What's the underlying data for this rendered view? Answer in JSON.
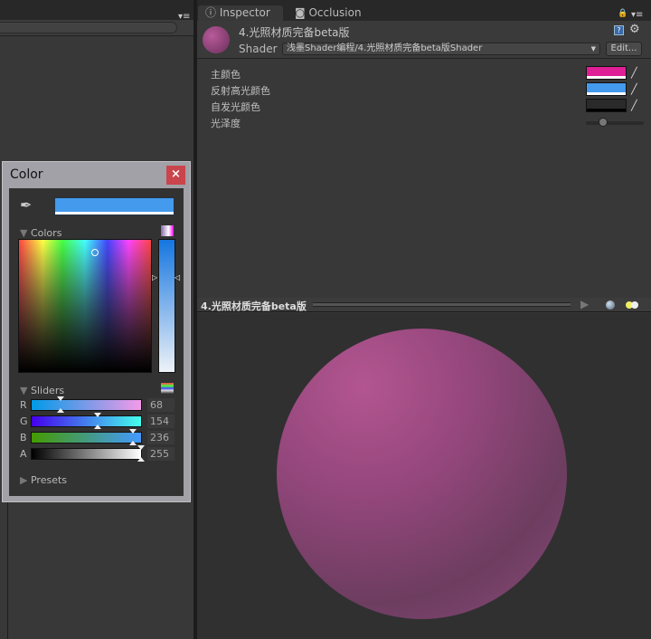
{
  "tabs": [
    {
      "label": "Inspector",
      "icon": "info-icon",
      "active": true
    },
    {
      "label": "Occlusion",
      "icon": "occlusion-icon",
      "active": false
    }
  ],
  "material": {
    "name": "4.光照材质完备beta版",
    "shader_label": "Shader",
    "shader_value": "浅墨Shader编程/4.光照材质完备beta版Shader",
    "edit_label": "Edit..."
  },
  "properties": [
    {
      "label": "主颜色",
      "type": "color",
      "color": "#e01e96"
    },
    {
      "label": "反射高光颜色",
      "type": "color",
      "color": "#449aec"
    },
    {
      "label": "自发光颜色",
      "type": "color",
      "color": "#2a2a2a"
    },
    {
      "label": "光泽度",
      "type": "slider",
      "value": 0.1
    }
  ],
  "preview": {
    "title": "4.光照材质完备beta版",
    "sphere_color": "#94477c"
  },
  "color_window": {
    "title": "Color",
    "close": "×",
    "current_color": "#449aec",
    "colors_label": "Colors",
    "sliders_label": "Sliders",
    "presets_label": "Presets",
    "channels": [
      {
        "name": "R",
        "value": "68"
      },
      {
        "name": "G",
        "value": "154"
      },
      {
        "name": "B",
        "value": "236"
      },
      {
        "name": "A",
        "value": "255"
      }
    ]
  }
}
